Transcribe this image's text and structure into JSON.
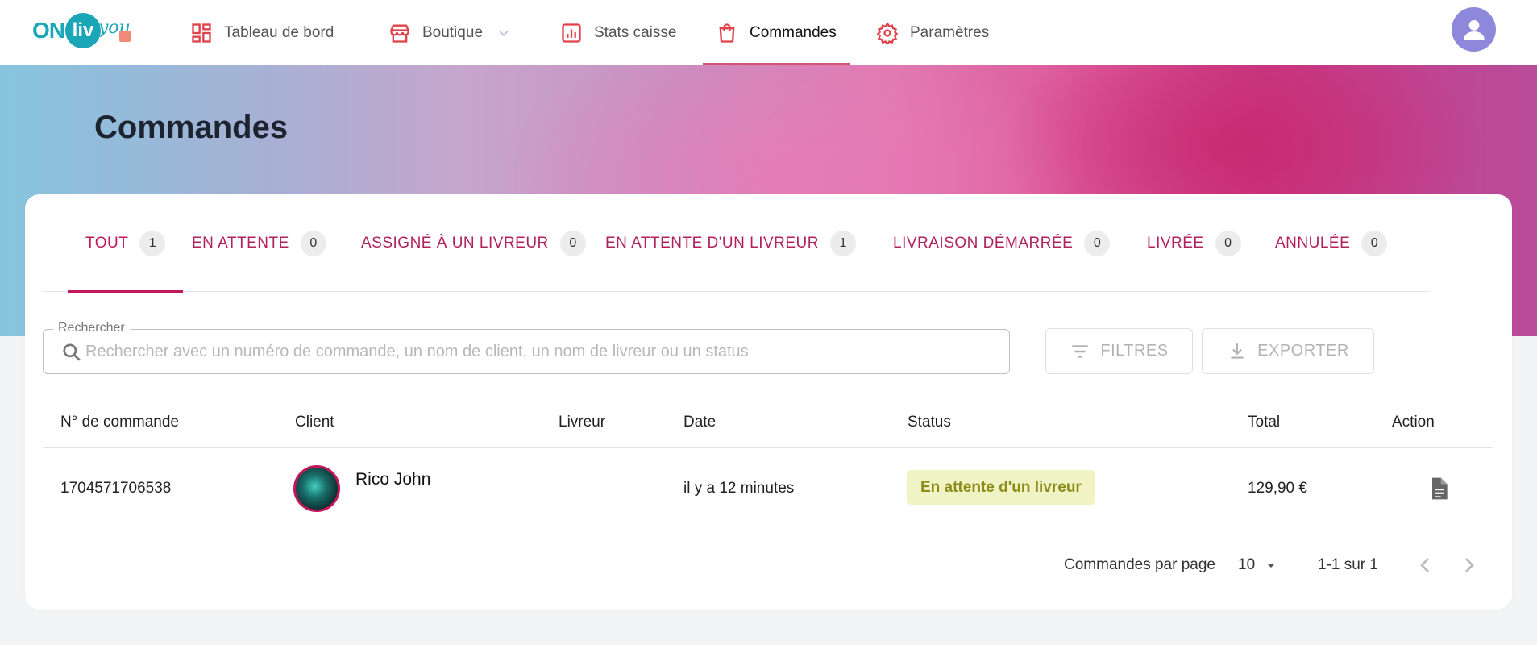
{
  "brand": {
    "logo_left": "ON",
    "logo_mid": "liv",
    "logo_right": "you",
    "accent": "#c2185b",
    "nav_accent": "#d35272"
  },
  "nav": {
    "items": [
      {
        "label": "Tableau de bord",
        "icon": "dashboard-icon"
      },
      {
        "label": "Boutique",
        "icon": "store-icon",
        "has_dropdown": true
      },
      {
        "label": "Stats caisse",
        "icon": "chart-icon"
      },
      {
        "label": "Commandes",
        "icon": "shopping-bag-icon",
        "active": true
      },
      {
        "label": "Paramètres",
        "icon": "gear-icon"
      }
    ],
    "avatar_icon": "user-icon"
  },
  "page": {
    "title": "Commandes"
  },
  "tabs": [
    {
      "label": "TOUT",
      "count": "1",
      "active": true
    },
    {
      "label": "EN ATTENTE",
      "count": "0"
    },
    {
      "label": "ASSIGNÉ À UN LIVREUR",
      "count": "0"
    },
    {
      "label": "EN ATTENTE D'UN LIVREUR",
      "count": "1"
    },
    {
      "label": "LIVRAISON DÉMARRÉE",
      "count": "0"
    },
    {
      "label": "LIVRÉE",
      "count": "0"
    },
    {
      "label": "ANNULÉE",
      "count": "0"
    }
  ],
  "search": {
    "label": "Rechercher",
    "placeholder": "Rechercher avec un numéro de commande, un nom de client, un nom de livreur ou un status",
    "value": ""
  },
  "buttons": {
    "filters": "FILTRES",
    "export": "EXPORTER"
  },
  "table": {
    "columns": [
      "N° de commande",
      "Client",
      "Livreur",
      "Date",
      "Status",
      "Total",
      "Action"
    ],
    "rows": [
      {
        "order_number": "1704571706538",
        "client": "Rico John",
        "courier": "",
        "date": "il y a 12 minutes",
        "status": "En attente d'un livreur",
        "status_color": "#8c8c1a",
        "total": "129,90 €",
        "action_icon": "document-icon"
      }
    ]
  },
  "pagination": {
    "rows_per_page_label": "Commandes par page",
    "rows_per_page": "10",
    "range": "1-1 sur 1"
  }
}
